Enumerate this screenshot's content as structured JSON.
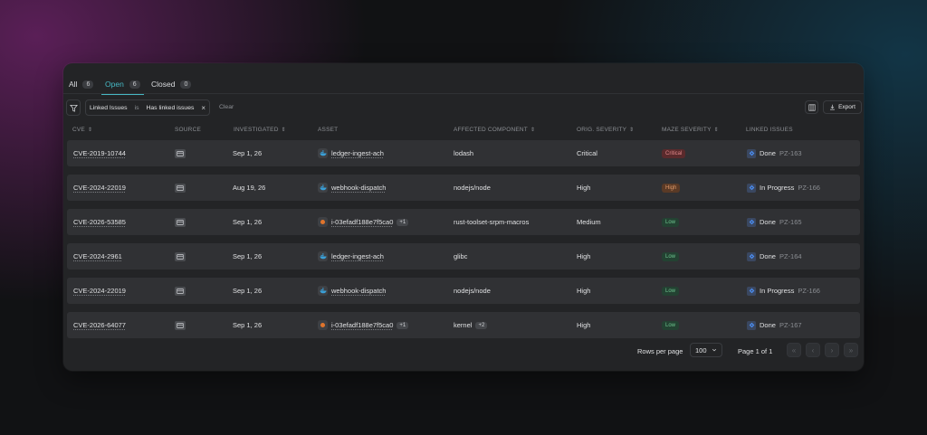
{
  "tabs": [
    {
      "label": "All",
      "count": "6"
    },
    {
      "label": "Open",
      "count": "6"
    },
    {
      "label": "Closed",
      "count": "0"
    }
  ],
  "filter": {
    "field": "Linked Issues",
    "operator": "is",
    "value": "Has linked issues",
    "remove": "×",
    "clear_label": "Clear"
  },
  "toolbar": {
    "export_label": "Export"
  },
  "columns": [
    "CVE",
    "SOURCE",
    "INVESTIGATED",
    "ASSET",
    "AFFECTED COMPONENT",
    "ORIG. SEVERITY",
    "MAZE SEVERITY",
    "LINKED ISSUES"
  ],
  "rows": [
    {
      "cve": "CVE-2019-10744",
      "investigated": "Sep 1, 26",
      "asset": "ledger-ingest-ach",
      "asset_extra": "",
      "component": "lodash",
      "component_extra": "",
      "orig_severity": "Critical",
      "maze_severity": "Critical",
      "issue_status": "Done",
      "issue_key": "PZ-163"
    },
    {
      "cve": "CVE-2024-22019",
      "investigated": "Aug 19, 26",
      "asset": "webhook-dispatch",
      "asset_extra": "",
      "component": "nodejs/node",
      "component_extra": "",
      "orig_severity": "High",
      "maze_severity": "High",
      "issue_status": "In Progress",
      "issue_key": "PZ-166"
    },
    {
      "cve": "CVE-2026-53585",
      "investigated": "Sep 1, 26",
      "asset": "i-03efadf188e7f5ca0",
      "asset_extra": "+1",
      "component": "rust-toolset-srpm-macros",
      "component_extra": "",
      "orig_severity": "Medium",
      "maze_severity": "Low",
      "issue_status": "Done",
      "issue_key": "PZ-165"
    },
    {
      "cve": "CVE-2024-2961",
      "investigated": "Sep 1, 26",
      "asset": "ledger-ingest-ach",
      "asset_extra": "",
      "component": "glibc",
      "component_extra": "",
      "orig_severity": "High",
      "maze_severity": "Low",
      "issue_status": "Done",
      "issue_key": "PZ-164"
    },
    {
      "cve": "CVE-2024-22019",
      "investigated": "Sep 1, 26",
      "asset": "webhook-dispatch",
      "asset_extra": "",
      "component": "nodejs/node",
      "component_extra": "",
      "orig_severity": "High",
      "maze_severity": "Low",
      "issue_status": "In Progress",
      "issue_key": "PZ-166"
    },
    {
      "cve": "CVE-2026-64077",
      "investigated": "Sep 1, 26",
      "asset": "i-03efadf188e7f5ca0",
      "asset_extra": "+1",
      "component": "kernel",
      "component_extra": "+2",
      "orig_severity": "High",
      "maze_severity": "Low",
      "issue_status": "Done",
      "issue_key": "PZ-167"
    }
  ],
  "pagination": {
    "rows_per_page_label": "Rows per page",
    "rows_per_page": "100",
    "page_info": "Page 1 of 1"
  }
}
